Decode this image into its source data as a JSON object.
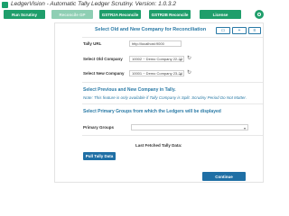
{
  "window": {
    "title": "LedgerVision - Automatic Tally Ledger Scrutiny.  Version: 1.0.3.2"
  },
  "tabs": [
    {
      "label": "Run Scrutiny",
      "state": "active"
    },
    {
      "label": "Reconcile GP",
      "state": "disabled"
    },
    {
      "label": "GSTR2A Reconcile",
      "state": "active"
    },
    {
      "label": "GSTR2B Reconcile",
      "state": "active"
    },
    {
      "label": "License",
      "state": "active"
    }
  ],
  "settings": {
    "icon": "gear-icon"
  },
  "toolbar": {
    "buttons": [
      {
        "icon": "new-icon"
      },
      {
        "icon": "add-icon"
      },
      {
        "icon": "menu-icon"
      }
    ]
  },
  "form": {
    "heading": "Select Old and New Company for Reconciliation",
    "tally_url_label": "Tally URL",
    "tally_url_value": "http://localhost:9000",
    "old_company_label": "Select Old Company",
    "old_company_value": "10002 ~ Demo Company 22-23",
    "new_company_label": "Select New Company",
    "new_company_value": "10001 ~ Demo Company 23-24",
    "previous_new_heading": "Select Previous and New Company in Tally.",
    "note": "Note: This feature is only available if Tally Company is Split. Scrutiny Period Do Not Matter.",
    "primary_groups_heading": "Select Primary Groups from which the Ledgers will be displayed",
    "primary_groups_label": "Primary Groups",
    "primary_groups_value": "",
    "last_fetched_label": "Last Fetched Tally Data:",
    "pull_button": "Pull Tally Data",
    "continue_button": "Continue"
  },
  "colors": {
    "brand_green": "#1f9e6b",
    "heading_blue": "#2a7aa6",
    "button_blue": "#1f6fa5"
  }
}
